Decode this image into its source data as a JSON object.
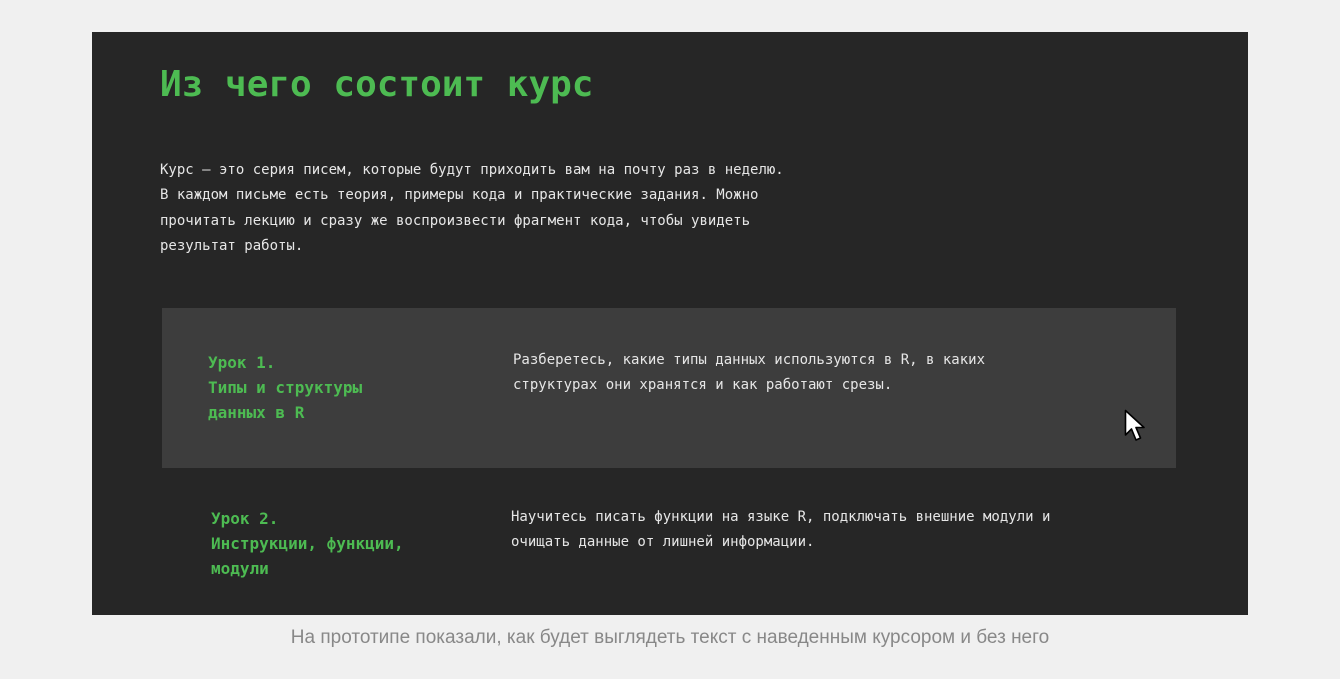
{
  "page": {
    "title": "Из чего состоит курс",
    "intro": "Курс — это серия писем, которые будут приходить вам на почту раз в неделю. В каждом письме есть теория, примеры кода и практические задания. Можно прочитать лекцию и сразу же воспроизвести фрагмент кода, чтобы увидеть результат работы."
  },
  "lessons": [
    {
      "title_lines": [
        "Урок 1.",
        "Типы и структуры",
        "данных в R"
      ],
      "description": "Разберетесь, какие типы данных используются в R, в каких структурах они хранятся и как работают срезы.",
      "hovered": true
    },
    {
      "title_lines": [
        "Урок 2.",
        "Инструкции, функции,",
        "модули"
      ],
      "description": "Научитесь писать функции на языке R, подключать внешние модули и очищать данные от лишней информации.",
      "hovered": false
    }
  ],
  "caption": "На прототипе показали, как будет выглядеть текст с наведенным курсором и без него",
  "colors": {
    "accent_green": "#4dbb52",
    "frame_background": "#262626",
    "hover_background": "#3d3d3d",
    "body_text": "#e6e6e6",
    "caption_text": "#888888"
  },
  "icons": {
    "cursor": "mouse-pointer-icon"
  }
}
